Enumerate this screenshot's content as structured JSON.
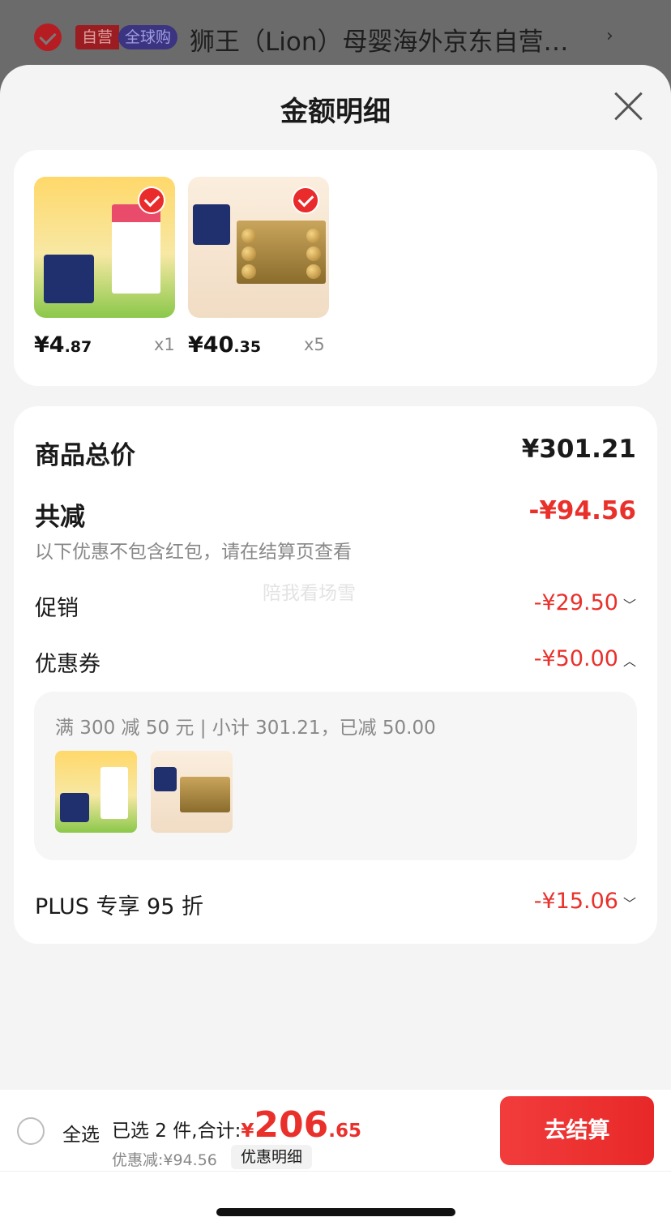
{
  "background_item": {
    "tag_self": "自营",
    "tag_global": "全球购",
    "title": "狮王（Lion）母婴海外京东自营…",
    "arrow": "›"
  },
  "sheet": {
    "title": "金额明细",
    "close_icon": "close-icon"
  },
  "products": [
    {
      "price_int": "¥4",
      "price_dec": ".87",
      "qty": "x1",
      "selected": true
    },
    {
      "price_int": "¥40",
      "price_dec": ".35",
      "qty": "x5",
      "selected": true
    }
  ],
  "detail": {
    "goods_total_label": "商品总价",
    "goods_total_value": "¥301.21",
    "reduce_label": "共减",
    "reduce_value": "-¥94.56",
    "reduce_note": "以下优惠不包含红包，请在结算页查看",
    "promo_label": "促销",
    "promo_value": "-¥29.50",
    "coupon_label": "优惠券",
    "coupon_value": "-¥50.00",
    "coupon_desc": "满 300 减 50 元 | 小计 301.21，已减 50.00",
    "plus_label": "PLUS 专享 95 折",
    "plus_value": "-¥15.06",
    "watermark": "陪我看场雪"
  },
  "bottom_bar": {
    "select_all": "全选",
    "selected_text": "已选 2 件,合计:",
    "total_currency": "¥",
    "total_int": "206",
    "total_dec": ".65",
    "discount_text": "优惠减:¥94.56",
    "detail_button": "优惠明细",
    "checkout_button": "去结算"
  },
  "colors": {
    "accent_red": "#e9302b",
    "checkout_red": "#f23c3c",
    "sheet_bg": "#f4f4f4"
  }
}
